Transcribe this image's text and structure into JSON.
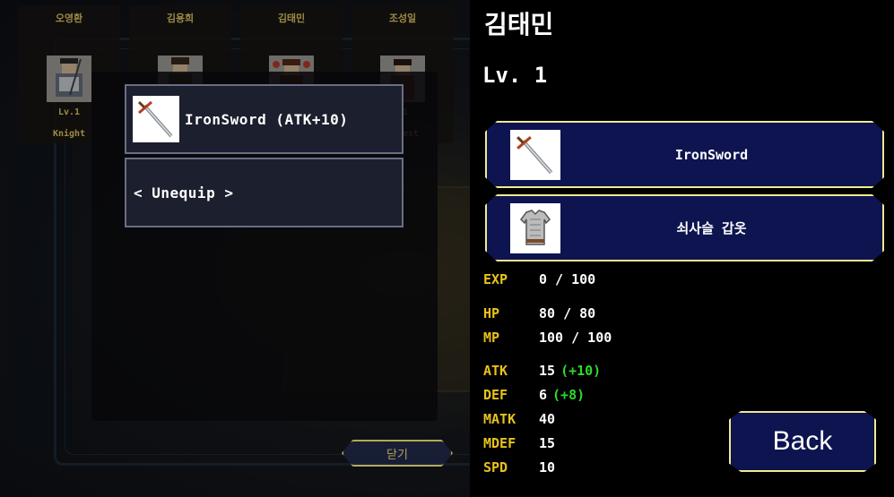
{
  "roster": [
    {
      "name": "오영환",
      "level": "Lv.1",
      "class": "Knight"
    },
    {
      "name": "김용희",
      "level": "",
      "class": "…ry"
    },
    {
      "name": "김태민",
      "level": "",
      "class": "…agic"
    },
    {
      "name": "조성일",
      "level": "…1",
      "class": "Priest"
    }
  ],
  "equip_menu": {
    "options": [
      {
        "label": "IronSword (ATK+10)",
        "icon": "sword-icon"
      },
      {
        "label": "< Unequip >"
      }
    ],
    "close_label": "닫기"
  },
  "detail": {
    "name": "김태민",
    "level": "Lv. 1",
    "weapon": {
      "label": "IronSword",
      "icon": "sword-icon"
    },
    "armor": {
      "label": "쇠사슬 갑옷",
      "icon": "chainmail-icon"
    },
    "stats": {
      "exp": {
        "key": "EXP",
        "value": "0 / 100"
      },
      "hp": {
        "key": "HP",
        "value": "80 / 80"
      },
      "mp": {
        "key": "MP",
        "value": "100 / 100"
      },
      "atk": {
        "key": "ATK",
        "value": "15",
        "bonus": "(+10)"
      },
      "def": {
        "key": "DEF",
        "value": "6",
        "bonus": "(+8)"
      },
      "matk": {
        "key": "MATK",
        "value": "40"
      },
      "mdef": {
        "key": "MDEF",
        "value": "15"
      },
      "spd": {
        "key": "SPD",
        "value": "10"
      }
    },
    "back_label": "Back"
  },
  "colors": {
    "accent_gold": "#e8c21c",
    "bonus_green": "#2bdb2b",
    "panel_navy": "#0d1450",
    "border_yellow": "#f0ea8e"
  }
}
